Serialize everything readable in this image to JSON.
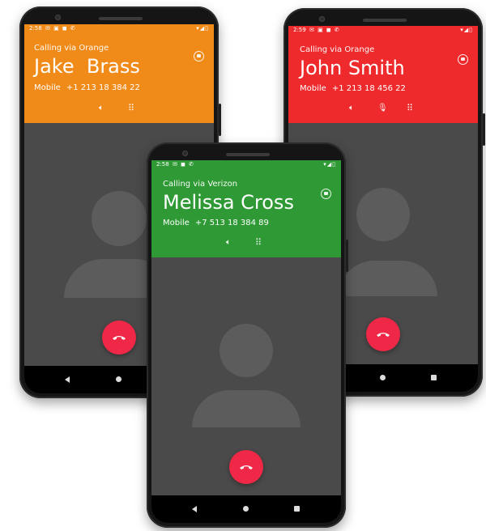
{
  "phones": {
    "left": {
      "status_time": "2:58",
      "status_notifs": "✉ ▣ ◼ ✆",
      "status_right": "▾◢▯",
      "via": "Calling via Orange",
      "name": "Jake  Brass",
      "number_label": "Mobile",
      "number": "+1 213 18 384 22",
      "header_color": "#f08a19"
    },
    "right": {
      "status_time": "2:59",
      "status_notifs": "✉ ▣ ◼ ✆",
      "status_right": "▾◢▯",
      "via": "Calling via Orange",
      "name": "John Smith",
      "number_label": "Mobile",
      "number": "+1 213 18 456 22",
      "header_color": "#ee2a2c"
    },
    "center": {
      "status_time": "2:58",
      "status_notifs": "✉ ◼ ✆",
      "status_right": "▾◢▯",
      "via": "Calling via Verizon",
      "name": "Melissa Cross",
      "number_label": "Mobile",
      "number": "+7 513 18 384 89",
      "header_color": "#2f9a35"
    }
  },
  "icons": {
    "speaker": "speaker-icon",
    "mute": "mic-off-icon",
    "keypad": "dialpad-icon",
    "lock": "lock-icon",
    "hangup": "hangup-icon",
    "nav_back": "back-icon",
    "nav_home": "home-icon",
    "nav_recent": "recents-icon"
  },
  "colors": {
    "hangup": "#ef2847",
    "screen_bg": "#4a4a4a",
    "avatar": "#5c5c5c"
  }
}
